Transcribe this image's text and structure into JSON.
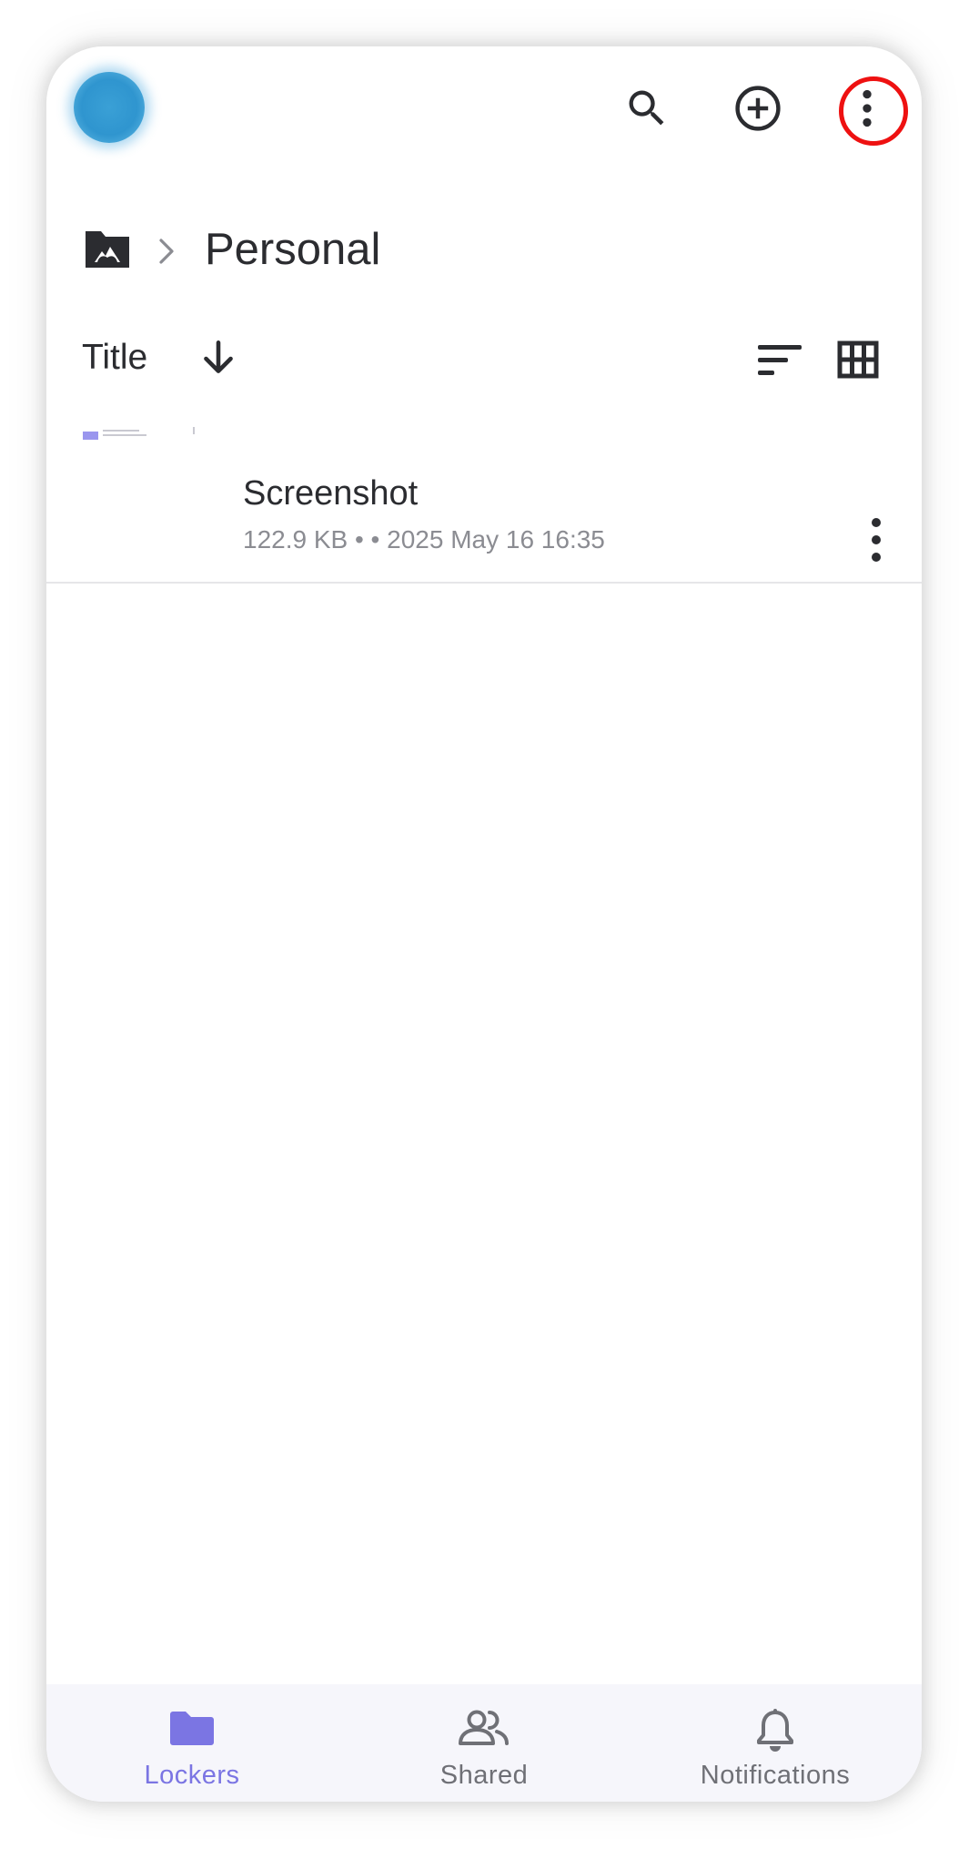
{
  "top_bar": {
    "avatar": "avatar",
    "icons": [
      "search-icon",
      "add-circle-icon",
      "more-vert-icon"
    ]
  },
  "breadcrumb": {
    "root_icon": "locker-folder-icon",
    "separator_icon": "chevron-right-icon",
    "current": "Personal"
  },
  "sort": {
    "label": "Title",
    "direction_icon": "arrow-down-icon",
    "options_icon": "sort-lines-icon",
    "view_icon": "grid-view-icon"
  },
  "files": [
    {
      "title": "Screenshot",
      "meta": "122.9 KB •  • 2025 May 16 16:35",
      "menu_icon": "more-vert-icon"
    }
  ],
  "bottom_nav": {
    "items": [
      {
        "label": "Lockers",
        "icon": "folder-icon",
        "active": true
      },
      {
        "label": "Shared",
        "icon": "people-icon",
        "active": false
      },
      {
        "label": "Notifications",
        "icon": "bell-icon",
        "active": false
      }
    ]
  },
  "colors": {
    "accent": "#7b75e3",
    "text_primary": "#2b2c30",
    "text_secondary": "#8b8c92",
    "nav_inactive": "#6f7076",
    "nav_background": "#f6f6fb",
    "highlight": "#ee1111",
    "avatar": "#3aa0d6"
  }
}
